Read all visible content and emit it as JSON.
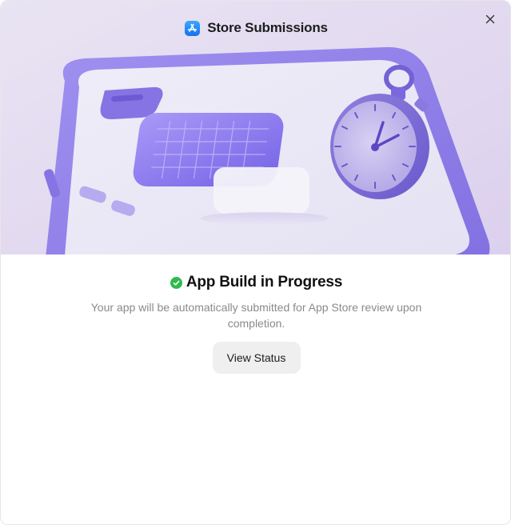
{
  "header": {
    "title": "Store Submissions",
    "icon": "app-store-icon"
  },
  "close_button": {
    "icon": "close-icon"
  },
  "hero": {
    "illustration": "phone-and-stopwatch-illustration",
    "colors": {
      "background": "#e4dcf0",
      "accent": "#7a68e6"
    }
  },
  "status": {
    "icon": "check-circle-icon",
    "title": "App Build in Progress",
    "description": "Your app will be automatically submitted for App Store review upon completion.",
    "color": "#30b94d"
  },
  "actions": {
    "view_status_label": "View Status"
  }
}
